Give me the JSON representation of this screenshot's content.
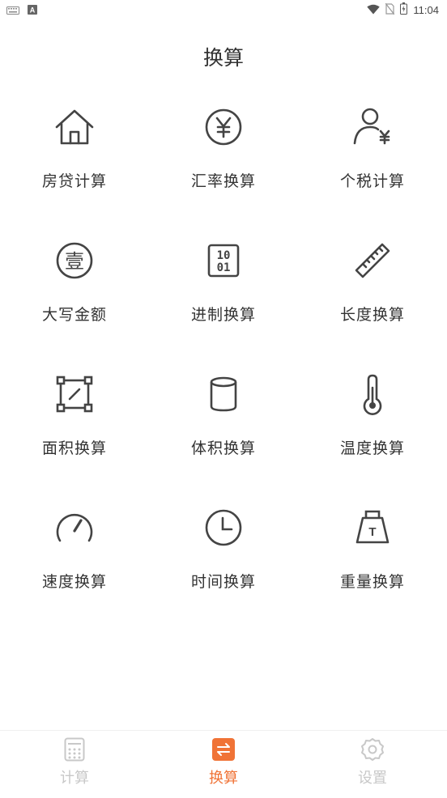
{
  "status_bar": {
    "time": "11:04",
    "left_icons": [
      "keyboard-icon",
      "a-badge-icon"
    ],
    "right_icons": [
      "wifi-icon",
      "no-sim-icon",
      "battery-icon"
    ]
  },
  "page": {
    "title": "换算"
  },
  "tools": [
    {
      "label": "房贷计算",
      "icon": "house-icon"
    },
    {
      "label": "汇率换算",
      "icon": "yen-circle-icon"
    },
    {
      "label": "个税计算",
      "icon": "person-yen-icon"
    },
    {
      "label": "大写金额",
      "icon": "chinese-numeral-icon"
    },
    {
      "label": "进制换算",
      "icon": "binary-icon"
    },
    {
      "label": "长度换算",
      "icon": "ruler-icon"
    },
    {
      "label": "面积换算",
      "icon": "area-icon"
    },
    {
      "label": "体积换算",
      "icon": "cylinder-icon"
    },
    {
      "label": "温度换算",
      "icon": "thermometer-icon"
    },
    {
      "label": "速度换算",
      "icon": "speedometer-icon"
    },
    {
      "label": "时间换算",
      "icon": "clock-icon"
    },
    {
      "label": "重量换算",
      "icon": "weight-icon"
    }
  ],
  "icon_glyphs": {
    "chinese_numeral": "壹",
    "binary_top": "10",
    "binary_bottom": "01",
    "weight_letter": "T",
    "yen": "¥"
  },
  "tabbar": {
    "tabs": [
      {
        "label": "计算",
        "icon": "calculator-icon",
        "active": false
      },
      {
        "label": "换算",
        "icon": "convert-icon",
        "active": true
      },
      {
        "label": "设置",
        "icon": "gear-icon",
        "active": false
      }
    ]
  },
  "colors": {
    "accent": "#f07336",
    "icon_stroke": "#444444",
    "inactive": "#c8c8c8",
    "text": "#333333"
  }
}
